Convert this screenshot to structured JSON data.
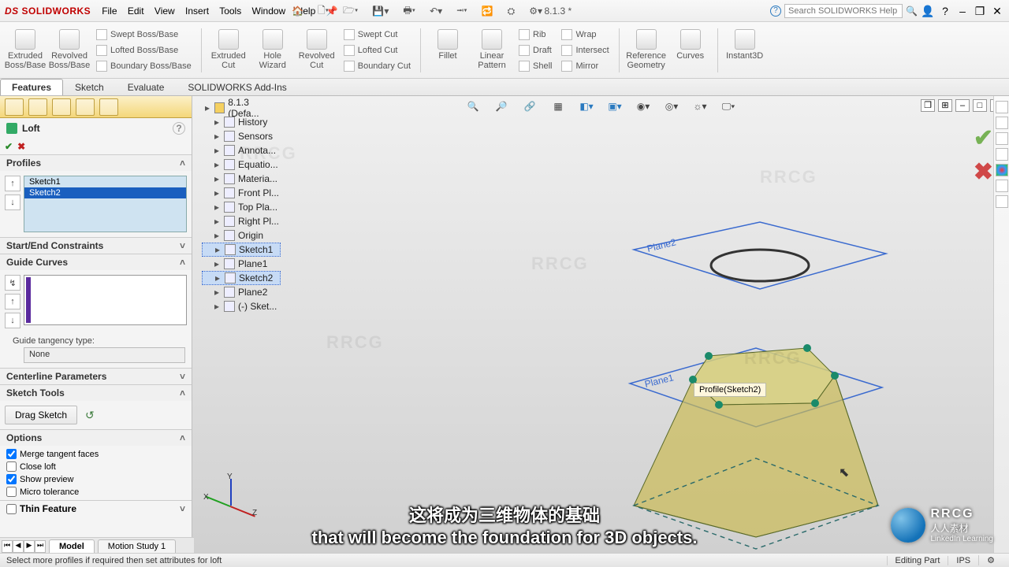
{
  "app": {
    "brand": "SOLIDWORKS",
    "ds": "DS",
    "doc_title": "8.1.3 *"
  },
  "menu": [
    "File",
    "Edit",
    "View",
    "Insert",
    "Tools",
    "Window",
    "Help"
  ],
  "search": {
    "placeholder": "Search SOLIDWORKS Help"
  },
  "window_buttons": {
    "min": "–",
    "restore": "❐",
    "close": "✕"
  },
  "ribbon_tabs": [
    "Features",
    "Sketch",
    "Evaluate",
    "SOLIDWORKS Add-Ins"
  ],
  "ribbon_tabs_active": 0,
  "ribbon": {
    "extruded_boss": "Extruded Boss/Base",
    "revolved_boss": "Revolved Boss/Base",
    "swept_boss": "Swept Boss/Base",
    "lofted_boss": "Lofted Boss/Base",
    "boundary_boss": "Boundary Boss/Base",
    "extruded_cut": "Extruded Cut",
    "hole_wizard": "Hole Wizard",
    "revolved_cut": "Revolved Cut",
    "swept_cut": "Swept Cut",
    "lofted_cut": "Lofted Cut",
    "boundary_cut": "Boundary Cut",
    "fillet": "Fillet",
    "linear_pattern": "Linear Pattern",
    "rib": "Rib",
    "draft": "Draft",
    "shell": "Shell",
    "wrap": "Wrap",
    "intersect": "Intersect",
    "mirror": "Mirror",
    "ref_geom": "Reference Geometry",
    "curves": "Curves",
    "instant3d": "Instant3D"
  },
  "pm": {
    "title": "Loft",
    "ok": "✔",
    "cancel": "✖",
    "sections": {
      "profiles": "Profiles",
      "constraints": "Start/End Constraints",
      "guides": "Guide Curves",
      "centerline": "Centerline Parameters",
      "sketchtools": "Sketch Tools",
      "options": "Options",
      "thin": "Thin Feature"
    },
    "profiles_items": [
      "Sketch1",
      "Sketch2"
    ],
    "profiles_selected": 1,
    "guide_tangency_label": "Guide tangency type:",
    "guide_tangency_value": "None",
    "drag_sketch": "Drag Sketch",
    "options_items": [
      {
        "label": "Merge tangent faces",
        "checked": true
      },
      {
        "label": "Close loft",
        "checked": false
      },
      {
        "label": "Show preview",
        "checked": true
      },
      {
        "label": "Micro tolerance",
        "checked": false
      }
    ],
    "thin_checked": false
  },
  "tree": {
    "root": "8.1.3 (Defa...",
    "items": [
      {
        "label": "History"
      },
      {
        "label": "Sensors"
      },
      {
        "label": "Annota..."
      },
      {
        "label": "Equatio..."
      },
      {
        "label": "Materia..."
      },
      {
        "label": "Front Pl..."
      },
      {
        "label": "Top Pla..."
      },
      {
        "label": "Right Pl..."
      },
      {
        "label": "Origin"
      },
      {
        "label": "Sketch1",
        "selected": true
      },
      {
        "label": "Plane1"
      },
      {
        "label": "Sketch2",
        "selected": true
      },
      {
        "label": "Plane2"
      },
      {
        "label": "(-) Sket..."
      }
    ]
  },
  "viewport": {
    "plane1_label": "Plane1",
    "plane2_label": "Plane2",
    "profile_callout": "Profile(Sketch2)"
  },
  "bottom_tabs": {
    "model": "Model",
    "motion": "Motion Study 1",
    "active": 0
  },
  "statusbar": {
    "hint": "Select more profiles if required then set attributes for loft",
    "mode": "Editing Part",
    "units": "IPS"
  },
  "subtitle": {
    "zh": "这将成为三维物体的基础",
    "en": "that will become the foundation for 3D objects."
  },
  "branding": {
    "site": "人人素材",
    "linkedin": "LinkedIn Learning"
  },
  "watermark": "RRCG"
}
